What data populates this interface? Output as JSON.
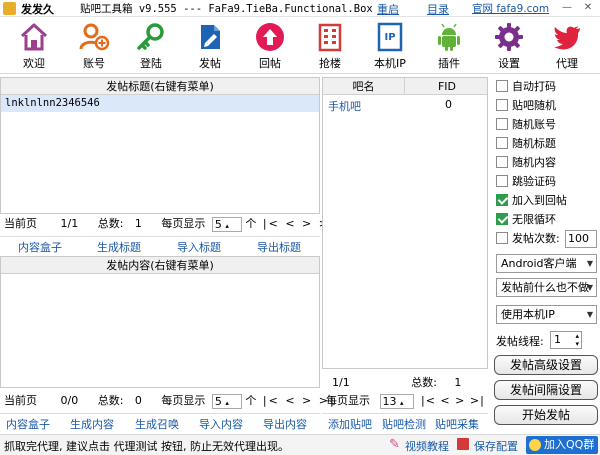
{
  "titlebar": {
    "app_name": "发发久",
    "subtitle": "贴吧工具箱 v9.555 --- FaFa9.TieBa.Functional.Box",
    "restart": "重启",
    "directory": "目录",
    "site": "官网 fafa9.com",
    "minimize": "—",
    "close": "✕"
  },
  "toolbar": {
    "items": [
      {
        "label": "欢迎",
        "icon": "home-icon",
        "color": "#9b3f8e"
      },
      {
        "label": "账号",
        "icon": "user-add-icon",
        "color": "#e36b1e"
      },
      {
        "label": "登陆",
        "icon": "key-icon",
        "color": "#2a9b3b"
      },
      {
        "label": "发帖",
        "icon": "pen-doc-icon",
        "color": "#1f63b5"
      },
      {
        "label": "回帖",
        "icon": "up-arrow-icon",
        "color": "#e21a55"
      },
      {
        "label": "抢楼",
        "icon": "building-icon",
        "color": "#d33b3b"
      },
      {
        "label": "本机IP",
        "icon": "ip-icon",
        "color": "#1f63b5"
      },
      {
        "label": "插件",
        "icon": "android-icon",
        "color": "#5fb23a"
      },
      {
        "label": "设置",
        "icon": "gear-icon",
        "color": "#7b2f8c"
      },
      {
        "label": "代理",
        "icon": "bird-icon",
        "color": "#e0223f"
      }
    ]
  },
  "title_panel": {
    "header": "发帖标题(右键有菜单)",
    "rows": [
      "lnklnlnn2346546"
    ],
    "pager": {
      "current_label": "当前页",
      "page": "1/1",
      "total_label": "总数:",
      "total": "1",
      "per_page_label": "每页显示",
      "per_page": "5",
      "unit": "个",
      "nav": "|< < > >|"
    },
    "actions": [
      "内容盒子",
      "生成标题",
      "导入标题",
      "导出标题"
    ]
  },
  "content_panel": {
    "header": "发帖内容(右键有菜单)",
    "pager": {
      "current_label": "当前页",
      "page": "0/0",
      "total_label": "总数:",
      "total": "0",
      "per_page_label": "每页显示",
      "per_page": "5",
      "unit": "个",
      "nav": "|< < > >|"
    },
    "actions": [
      "内容盒子",
      "生成内容",
      "生成召唤",
      "导入内容",
      "导出内容"
    ]
  },
  "bar_panel": {
    "col_name": "吧名",
    "col_fid": "FID",
    "rows": [
      {
        "name": "手机吧",
        "fid": "0"
      }
    ],
    "pager": {
      "page": "1/1",
      "total_label": "总数:",
      "total": "1",
      "per_page_label": "每页显示",
      "per_page": "13",
      "nav": "|< < > >|"
    },
    "actions": [
      "添加贴吧",
      "贴吧检测",
      "贴吧采集"
    ]
  },
  "options": {
    "checkboxes": [
      {
        "label": "自动打码",
        "checked": false
      },
      {
        "label": "贴吧随机",
        "checked": false
      },
      {
        "label": "随机账号",
        "checked": false
      },
      {
        "label": "随机标题",
        "checked": false
      },
      {
        "label": "随机内容",
        "checked": false
      },
      {
        "label": "跳验证码",
        "checked": false
      },
      {
        "label": "加入到回帖",
        "checked": true
      },
      {
        "label": "无限循环",
        "checked": true
      }
    ],
    "post_count_label": "发帖次数:",
    "post_count": "100",
    "client_select": "Android客户端",
    "before_post_select": "发帖前什么也不做",
    "ip_select": "使用本机IP",
    "threads_label": "发帖线程:",
    "threads": "1",
    "advanced_button": "发帖高级设置",
    "interval_button": "发帖间隔设置",
    "start_button": "开始发帖"
  },
  "statusbar": {
    "message": "抓取完代理, 建议点击 代理测试 按钮, 防止无效代理出现。",
    "video": "视频教程",
    "save": "保存配置",
    "qq": "加入QQ群"
  }
}
